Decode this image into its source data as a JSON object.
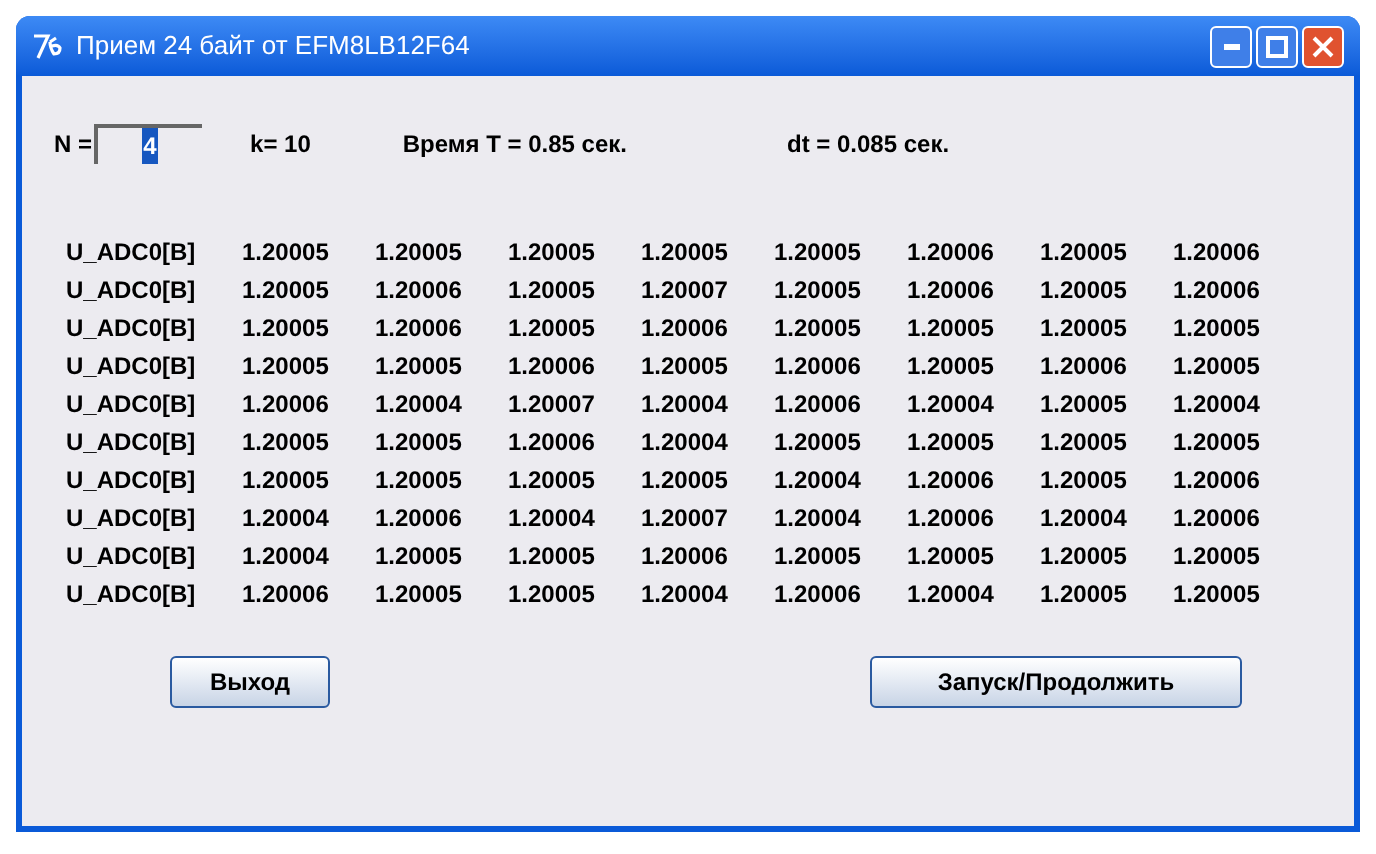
{
  "window": {
    "title": "Прием 24 байт от EFM8LB12F64"
  },
  "params": {
    "n_label": "N =",
    "n_field": {
      "value": "4",
      "value_selected": true
    },
    "k": "k= 10",
    "time": "Время T = 0.85 сек.",
    "dt": "dt = 0.085 сек."
  },
  "rows": [
    {
      "label": "U_ADC0[B]",
      "values": [
        "1.20005",
        "1.20005",
        "1.20005",
        "1.20005",
        "1.20005",
        "1.20006",
        "1.20005",
        "1.20006"
      ]
    },
    {
      "label": "U_ADC0[B]",
      "values": [
        "1.20005",
        "1.20006",
        "1.20005",
        "1.20007",
        "1.20005",
        "1.20006",
        "1.20005",
        "1.20006"
      ]
    },
    {
      "label": "U_ADC0[B]",
      "values": [
        "1.20005",
        "1.20006",
        "1.20005",
        "1.20006",
        "1.20005",
        "1.20005",
        "1.20005",
        "1.20005"
      ]
    },
    {
      "label": "U_ADC0[B]",
      "values": [
        "1.20005",
        "1.20005",
        "1.20006",
        "1.20005",
        "1.20006",
        "1.20005",
        "1.20006",
        "1.20005"
      ]
    },
    {
      "label": "U_ADC0[B]",
      "values": [
        "1.20006",
        "1.20004",
        "1.20007",
        "1.20004",
        "1.20006",
        "1.20004",
        "1.20005",
        "1.20004"
      ]
    },
    {
      "label": "U_ADC0[B]",
      "values": [
        "1.20005",
        "1.20005",
        "1.20006",
        "1.20004",
        "1.20005",
        "1.20005",
        "1.20005",
        "1.20005"
      ]
    },
    {
      "label": "U_ADC0[B]",
      "values": [
        "1.20005",
        "1.20005",
        "1.20005",
        "1.20005",
        "1.20004",
        "1.20006",
        "1.20005",
        "1.20006"
      ]
    },
    {
      "label": "U_ADC0[B]",
      "values": [
        "1.20004",
        "1.20006",
        "1.20004",
        "1.20007",
        "1.20004",
        "1.20006",
        "1.20004",
        "1.20006"
      ]
    },
    {
      "label": "U_ADC0[B]",
      "values": [
        "1.20004",
        "1.20005",
        "1.20005",
        "1.20006",
        "1.20005",
        "1.20005",
        "1.20005",
        "1.20005"
      ]
    },
    {
      "label": "U_ADC0[B]",
      "values": [
        "1.20006",
        "1.20005",
        "1.20005",
        "1.20004",
        "1.20006",
        "1.20004",
        "1.20005",
        "1.20005"
      ]
    }
  ],
  "buttons": [
    "Выход",
    "Запуск/Продолжить"
  ]
}
